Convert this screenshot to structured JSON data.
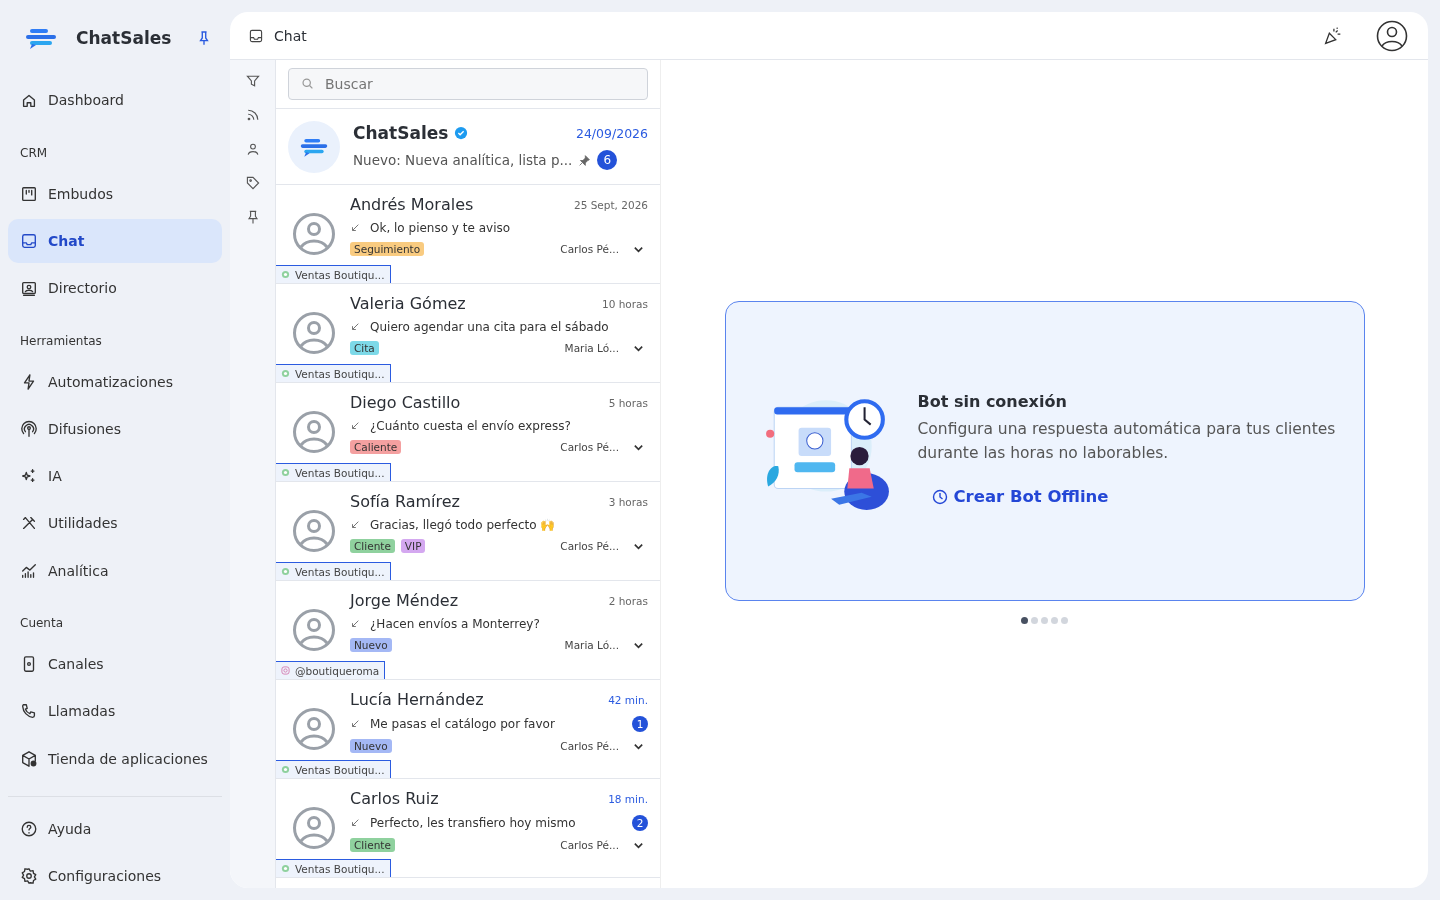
{
  "brand": {
    "name": "ChatSales"
  },
  "sidebar": {
    "sections": [
      {
        "items": [
          {
            "label": "Dashboard",
            "selected": false
          }
        ]
      },
      {
        "heading": "CRM",
        "items": [
          {
            "label": "Embudos",
            "selected": false
          },
          {
            "label": "Chat",
            "selected": true
          },
          {
            "label": "Directorio",
            "selected": false
          }
        ]
      },
      {
        "heading": "Herramientas",
        "items": [
          {
            "label": "Automatizaciones",
            "selected": false
          },
          {
            "label": "Difusiones",
            "selected": false
          },
          {
            "label": "IA",
            "selected": false
          },
          {
            "label": "Utilidades",
            "selected": false
          },
          {
            "label": "Analítica",
            "selected": false
          }
        ]
      },
      {
        "heading": "Cuenta",
        "items": [
          {
            "label": "Canales",
            "selected": false
          },
          {
            "label": "Llamadas",
            "selected": false
          },
          {
            "label": "Tienda de aplicaciones",
            "selected": false
          }
        ]
      }
    ],
    "footer": [
      {
        "label": "Ayuda",
        "selected": false
      },
      {
        "label": "Configuraciones",
        "selected": false
      }
    ]
  },
  "header": {
    "title": "Chat"
  },
  "search": {
    "placeholder": "Buscar"
  },
  "pinned_chat": {
    "name": "ChatSales",
    "verified": true,
    "date": "24/09/2026",
    "preview": "Nuevo: Nueva analítica, lista p...",
    "pinned": true,
    "unread": "6"
  },
  "chats": [
    {
      "name": "Andrés Morales",
      "time": "25 Sept, 2026",
      "preview": "Ok, lo pienso y te aviso",
      "tags": [
        {
          "label": "Seguimiento",
          "color": "#f9cb80"
        }
      ],
      "agent": "Carlos Pé...",
      "channel": {
        "kind": "whatsapp",
        "label": "Ventas Boutiqu..."
      }
    },
    {
      "name": "Valeria Gómez",
      "time": "10 horas",
      "preview": "Quiero agendar una cita para el sábado",
      "tags": [
        {
          "label": "Cita",
          "color": "#7dd9e8"
        }
      ],
      "agent": "Maria Ló...",
      "channel": {
        "kind": "whatsapp",
        "label": "Ventas Boutiqu..."
      }
    },
    {
      "name": "Diego Castillo",
      "time": "5 horas",
      "preview": "¿Cuánto cuesta el envío express?",
      "tags": [
        {
          "label": "Caliente",
          "color": "#f4a0a0"
        }
      ],
      "agent": "Carlos Pé...",
      "channel": {
        "kind": "whatsapp",
        "label": "Ventas Boutiqu..."
      }
    },
    {
      "name": "Sofía Ramírez",
      "time": "3 horas",
      "preview": "Gracias, llegó todo perfecto 🙌",
      "tags": [
        {
          "label": "Cliente",
          "color": "#8fd19e"
        },
        {
          "label": "VIP",
          "color": "#d4a8f0"
        }
      ],
      "agent": "Carlos Pé...",
      "channel": {
        "kind": "whatsapp",
        "label": "Ventas Boutiqu..."
      }
    },
    {
      "name": "Jorge Méndez",
      "time": "2 horas",
      "preview": "¿Hacen envíos a Monterrey?",
      "tags": [
        {
          "label": "Nuevo",
          "color": "#a4b8f5"
        }
      ],
      "agent": "Maria Ló...",
      "channel": {
        "kind": "instagram",
        "label": "@boutiqueroma"
      }
    },
    {
      "name": "Lucía Hernández",
      "time": "42 min.",
      "preview": "Me pasas el catálogo por favor",
      "unread": "1",
      "tags": [
        {
          "label": "Nuevo",
          "color": "#a4b8f5"
        }
      ],
      "agent": "Carlos Pé...",
      "channel": {
        "kind": "whatsapp",
        "label": "Ventas Boutiqu..."
      }
    },
    {
      "name": "Carlos Ruiz",
      "time": "18 min.",
      "preview": "Perfecto, les transfiero hoy mismo",
      "unread": "2",
      "tags": [
        {
          "label": "Cliente",
          "color": "#8fd19e"
        }
      ],
      "agent": "Carlos Pé...",
      "channel": {
        "kind": "whatsapp",
        "label": "Ventas Boutiqu..."
      }
    }
  ],
  "promo": {
    "title": "Bot sin conexión",
    "text": "Configura una respuesta automática para tus clientes durante las horas no laborables.",
    "action": "Crear Bot Offline"
  },
  "carousel": [
    {
      "selected": true
    },
    {
      "selected": false
    },
    {
      "selected": false
    },
    {
      "selected": false
    },
    {
      "selected": false
    }
  ]
}
